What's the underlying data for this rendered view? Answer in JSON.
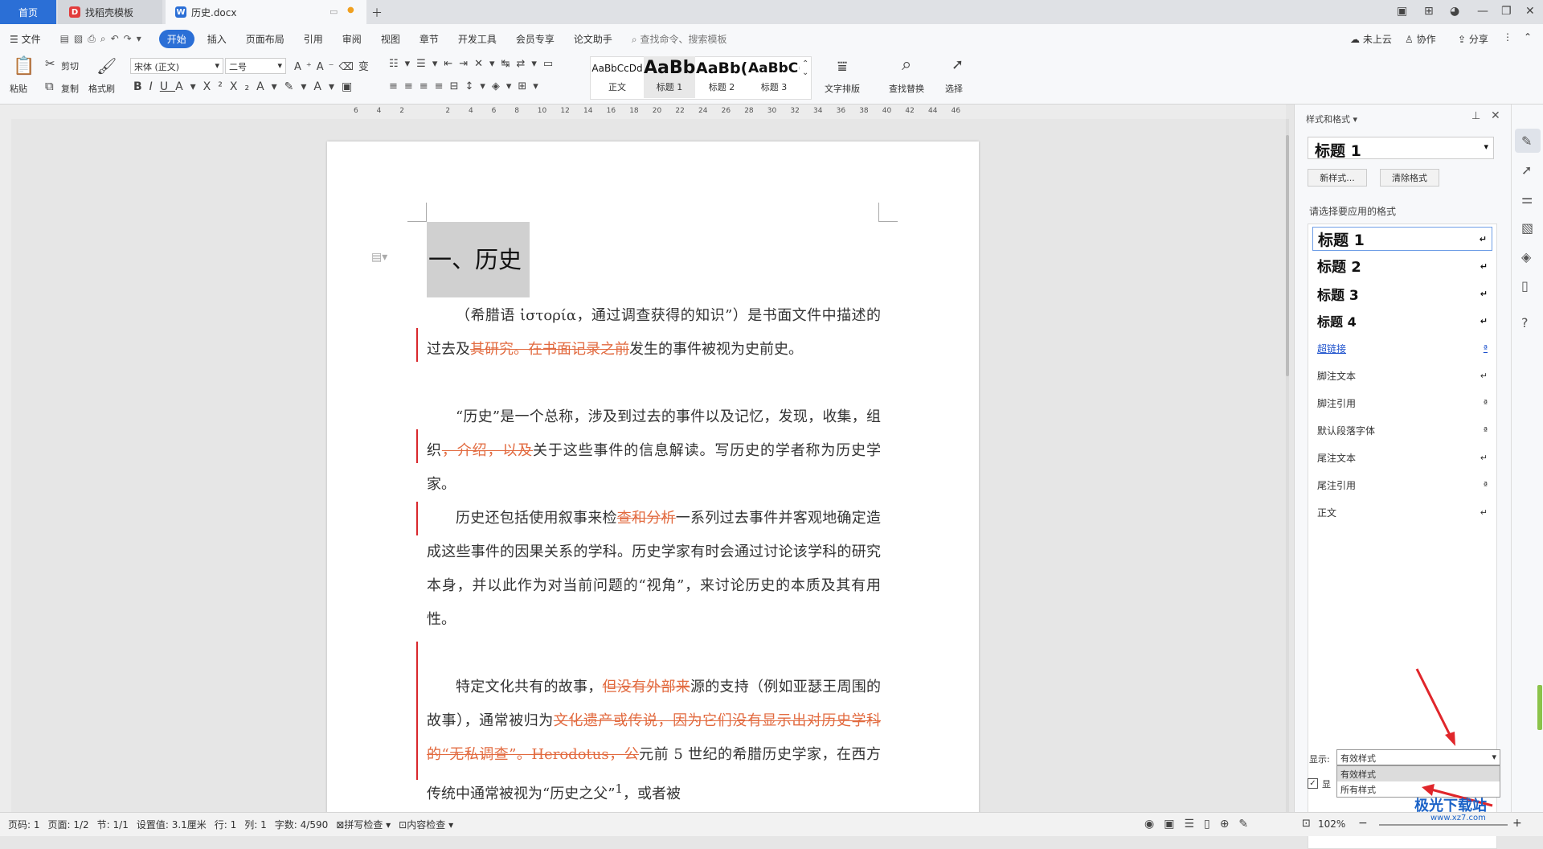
{
  "tabs": {
    "home": "首页",
    "template": "找稻壳模板",
    "doc": "历史.docx"
  },
  "menu": {
    "file": "文件",
    "items": [
      "开始",
      "插入",
      "页面布局",
      "引用",
      "审阅",
      "视图",
      "章节",
      "开发工具",
      "会员专享",
      "论文助手"
    ],
    "search": "查找命令、搜索模板",
    "right": {
      "cloud": "未上云",
      "collab": "协作",
      "share": "分享"
    }
  },
  "toolbar": {
    "paste": "粘贴",
    "cut": "剪切",
    "copy": "复制",
    "format_painter": "格式刷",
    "font": "宋体 (正文)",
    "size": "二号",
    "styles": [
      {
        "preview": "AaBbCcDd",
        "label": "正文"
      },
      {
        "preview": "AaBb",
        "label": "标题 1"
      },
      {
        "preview": "AaBb(",
        "label": "标题 2"
      },
      {
        "preview": "AaBbC(",
        "label": "标题 3"
      }
    ],
    "text_layout": "文字排版",
    "find_replace": "查找替换",
    "select": "选择"
  },
  "ruler": [
    "6",
    "4",
    "2",
    "",
    "2",
    "4",
    "6",
    "8",
    "10",
    "12",
    "14",
    "16",
    "18",
    "20",
    "22",
    "24",
    "26",
    "28",
    "30",
    "32",
    "34",
    "36",
    "38",
    "40",
    "42",
    "44",
    "46"
  ],
  "doc": {
    "heading": "一、历史",
    "p1a": "（希腊语 ἱστορία，通过调查获得的知识”）是书面文件中描述的过去及",
    "p1del": "其研究。在书面记录之前",
    "p1b": "发生的事件被视为史前史。",
    "p2a": "“历史”是一个总称，涉及到过去的事件以及记忆，发现，收集，组织",
    "p2del": "，介绍，以及",
    "p2b": "关于这些事件的信息解读。写历史的学者称为历史学家。",
    "p3a": "历史还包括使用叙事来检",
    "p3del": "查和分析",
    "p3b": "一系列过去事件并客观地确定造成这些事件的因果关系的学科。历史学家有时会通过讨论该学科的研究本身，并以此作为对当前问题的“视角”，来讨论历史的本质及其有用性。",
    "p4a": "特定文化共有的故事，",
    "p4del1": "但没有外部来",
    "p4b": "源的支持（例如亚瑟王周围的故事），通常被归为",
    "p4del2": "文化遗产或传说，因为它们没有显示出对历史学科的“无私调查”。Herodotus，公",
    "p4c": "元前 5 世纪的希腊历史学家，在西方传统中通常被视为“历史之父”",
    "p4sup": "1",
    "p4d": "，或者被"
  },
  "panel": {
    "title": "样式和格式",
    "current": "标题  1",
    "new_style": "新样式...",
    "clear_format": "清除格式",
    "prompt": "请选择要应用的格式",
    "styles": [
      "标题  1",
      "标题  2",
      "标题  3",
      "标题  4",
      "超链接",
      "脚注文本",
      "脚注引用",
      "默认段落字体",
      "尾注文本",
      "尾注引用",
      "正文"
    ],
    "show_label": "显示:",
    "show_value": "有效样式",
    "options": [
      "有效样式",
      "所有样式"
    ],
    "checkbox_label": "显"
  },
  "status": {
    "page_code": "页码: 1",
    "page": "页面: 1/2",
    "section": "节: 1/1",
    "setting": "设置值: 3.1厘米",
    "row": "行: 1",
    "col": "列: 1",
    "words": "字数: 4/590",
    "spell": "拼写检查",
    "content": "内容检查",
    "zoom": "102%"
  },
  "watermark": "极光下载站",
  "watermark_url": "www.xz7.com",
  "colors": {
    "accent": "#2b6fd6",
    "deleted": "#e26a3f",
    "revision_bar": "#d9272c",
    "arrow": "#e0262b"
  }
}
